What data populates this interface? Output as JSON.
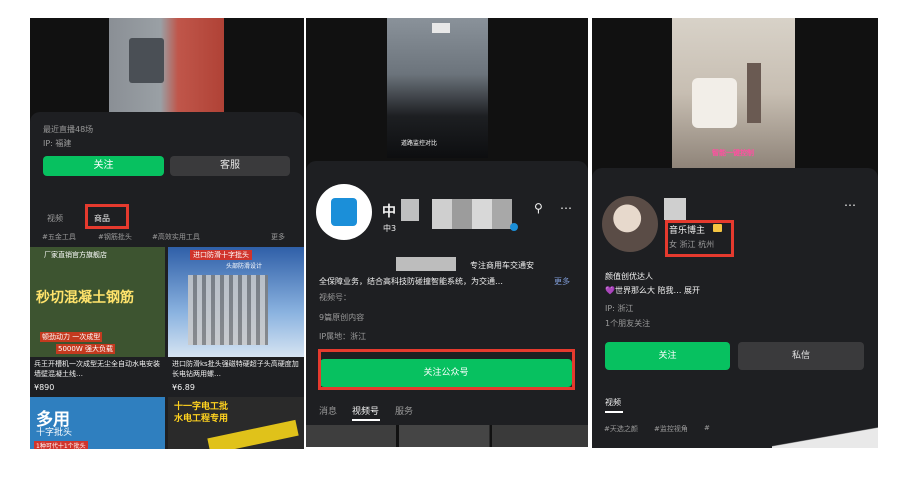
{
  "colors": {
    "accent": "#07c160",
    "highlight": "#e53a2e",
    "sheet": "#1e1f22",
    "button_dark": "#3a3a3c"
  },
  "panel1": {
    "live_count": "最近直播48场",
    "ip": "IP: 福建",
    "follow_label": "关注",
    "service_label": "客服",
    "tabs": [
      "视频",
      "商品"
    ],
    "chips": [
      "#五金工具",
      "#钢筋批头",
      "#高效实用工具",
      "更多"
    ],
    "products": [
      {
        "banner": "厂家直销官方旗舰店",
        "headline": "秒切混凝土钢筋",
        "promo": "顿劲动力 一次成型",
        "power": "5000W 强大负载",
        "title": "兵王开槽机一次成型无尘全自动水电安装墙壁混凝土线…",
        "price": "¥890"
      },
      {
        "banner": "进口防滑十字批头",
        "sub": "头部防滑设计",
        "title": "进口防滑ks批头强磁特硬超子头高硬度加长电钻两用螺…",
        "price": "¥6.89"
      },
      {
        "headline": "多用",
        "sub": "十字批头",
        "tag": "1种可代十1个批头"
      },
      {
        "banner": "十一字电工批",
        "sub": "水电工程专用"
      }
    ]
  },
  "panel2": {
    "video_caption": "道路监控对比",
    "name": "中",
    "name_sub": "中3",
    "search_icon": "search-icon",
    "more_icon": "more-icon",
    "desc_line1": "专注商用车交通安",
    "desc_line2": "全保障业务，结合高科技防碰撞智能系统，为交通…",
    "desc_more": "更多",
    "channel_label": "视频号：",
    "articles": "9篇原创内容",
    "ip": "IP属地：浙江",
    "follow_official": "关注公众号",
    "tabs": [
      "消息",
      "视频号",
      "服务"
    ]
  },
  "panel3": {
    "video_caption": "智能一键控制",
    "name": "音乐博主",
    "meta": "女 浙江 杭州",
    "bio1": "颜值创优达人",
    "bio2": "💜世界那么大 陪我… 展开",
    "ip": "IP: 浙江",
    "friends": "1个朋友关注",
    "follow_label": "关注",
    "message_label": "私信",
    "tab": "视频",
    "chips": [
      "#天选之颜",
      "#监控视角",
      "#"
    ]
  }
}
